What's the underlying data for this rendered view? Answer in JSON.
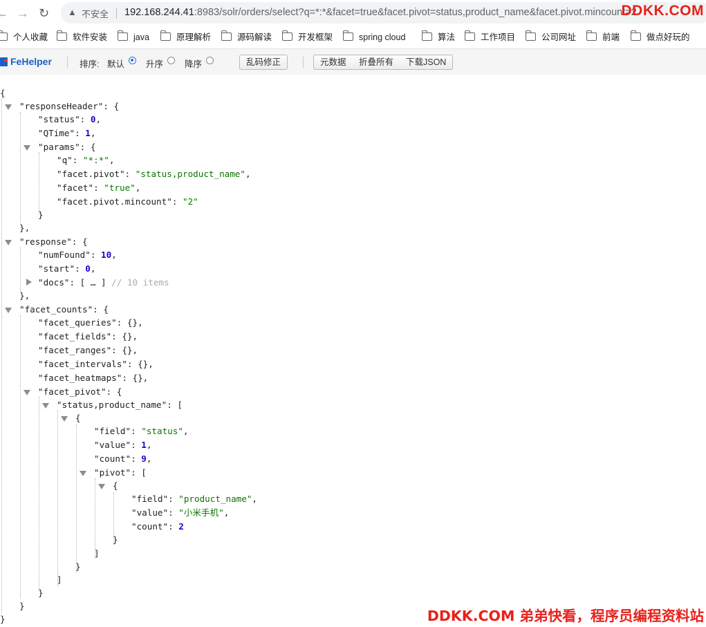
{
  "browser": {
    "insecure_label": "不安全",
    "url_host": "192.168.244.41",
    "url_rest": ":8983/solr/orders/select?q=*:*&facet=true&facet.pivot=status,product_name&facet.pivot.mincount=2"
  },
  "bookmarks": [
    "个人收藏",
    "软件安装",
    "java",
    "原理解析",
    "源码解读",
    "开发框架",
    "spring cloud",
    "算法",
    "工作项目",
    "公司网址",
    "前端",
    "做点好玩的"
  ],
  "fehelper": {
    "logo": "FeHelper",
    "sort_label": "排序:",
    "sort_default": "默认",
    "sort_asc": "升序",
    "sort_desc": "降序",
    "btn_fix": "乱码修正",
    "btn_raw": "元数据",
    "btn_fold": "折叠所有",
    "btn_download": "下载JSON"
  },
  "json": {
    "l1": "{",
    "l2_key": "\"responseHeader\"",
    "l2_rest": ": {",
    "l3_key": "\"status\"",
    "l3_val": "0",
    "l4_key": "\"QTime\"",
    "l4_val": "1",
    "l5_key": "\"params\"",
    "l5_rest": ": {",
    "l6_key": "\"q\"",
    "l6_val": "\"*:*\"",
    "l7_key": "\"facet.pivot\"",
    "l7_val": "\"status,product_name\"",
    "l8_key": "\"facet\"",
    "l8_val": "\"true\"",
    "l9_key": "\"facet.pivot.mincount\"",
    "l9_val": "\"2\"",
    "l10": "}",
    "l11": "},",
    "l12_key": "\"response\"",
    "l12_rest": ": {",
    "l13_key": "\"numFound\"",
    "l13_val": "10",
    "l14_key": "\"start\"",
    "l14_val": "0",
    "l15_key": "\"docs\"",
    "l15_rest": ": [ … ]",
    "l15_comment": "// 10 items",
    "l16": "},",
    "l17_key": "\"facet_counts\"",
    "l17_rest": ": {",
    "l18_key": "\"facet_queries\"",
    "l18_rest": ": {},",
    "l19_key": "\"facet_fields\"",
    "l19_rest": ": {},",
    "l20_key": "\"facet_ranges\"",
    "l20_rest": ": {},",
    "l21_key": "\"facet_intervals\"",
    "l21_rest": ": {},",
    "l22_key": "\"facet_heatmaps\"",
    "l22_rest": ": {},",
    "l23_key": "\"facet_pivot\"",
    "l23_rest": ": {",
    "l24_key": "\"status,product_name\"",
    "l24_rest": ": [",
    "l25": "{",
    "l26_key": "\"field\"",
    "l26_val": "\"status\"",
    "l27_key": "\"value\"",
    "l27_val": "1",
    "l28_key": "\"count\"",
    "l28_val": "9",
    "l29_key": "\"pivot\"",
    "l29_rest": ": [",
    "l30": "{",
    "l31_key": "\"field\"",
    "l31_val": "\"product_name\"",
    "l32_key": "\"value\"",
    "l32_val": "\"小米手机\"",
    "l33_key": "\"count\"",
    "l33_val": "2",
    "l34": "}",
    "l35": "]",
    "l36": "}",
    "l37": "]",
    "l38": "}",
    "l39": "}",
    "l40": "}"
  },
  "watermark_top": "DDKK.COM",
  "watermark_bottom": "DDKK.COM 弟弟快看，程序员编程资料站"
}
